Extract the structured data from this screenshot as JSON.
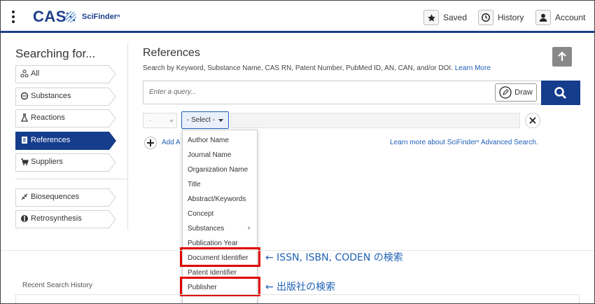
{
  "header": {
    "logo_text": "CAS",
    "product_name": "SciFinderⁿ",
    "saved_label": "Saved",
    "history_label": "History",
    "account_label": "Account"
  },
  "sidebar": {
    "title": "Searching for...",
    "items": [
      {
        "label": "All",
        "icon": "atom-icon"
      },
      {
        "label": "Substances",
        "icon": "substance-icon"
      },
      {
        "label": "Reactions",
        "icon": "flask-icon"
      },
      {
        "label": "References",
        "icon": "document-icon",
        "active": true
      },
      {
        "label": "Suppliers",
        "icon": "cart-icon"
      },
      {
        "label": "Biosequences",
        "icon": "dna-icon"
      },
      {
        "label": "Retrosynthesis",
        "icon": "retrosynthesis-icon"
      }
    ]
  },
  "main": {
    "title": "References",
    "description": "Search by Keyword, Substance Name, CAS RN, Patent Number, PubMed ID, AN, CAN, and/or DOI.",
    "learn_more": "Learn More",
    "query_placeholder": "Enter a query...",
    "draw_label": "Draw",
    "operator_value": "-",
    "field_select_value": "- Select -",
    "add_label": "Add Advanced Search Field",
    "learn_advanced": "Learn more about SciFinderⁿ Advanced Search.",
    "recent_history": "Recent Search History"
  },
  "dropdown": {
    "options": [
      "Author Name",
      "Journal Name",
      "Organization Name",
      "Title",
      "Abstract/Keywords",
      "Concept",
      "Substances",
      "Publication Year",
      "Document Identifier",
      "Patent Identifier",
      "Publisher"
    ],
    "submenu_chevron": "›"
  },
  "annotations": {
    "document_identifier_note": "← ISSN, ISBN, CODEN の検索",
    "publisher_note": "← 出版社の検索",
    "highlight_color": "#e00000",
    "note_color": "#1f62b5"
  },
  "colors": {
    "brand": "#1e3e8c",
    "active_nav": "#163c8c",
    "link": "#1f5fb8"
  }
}
